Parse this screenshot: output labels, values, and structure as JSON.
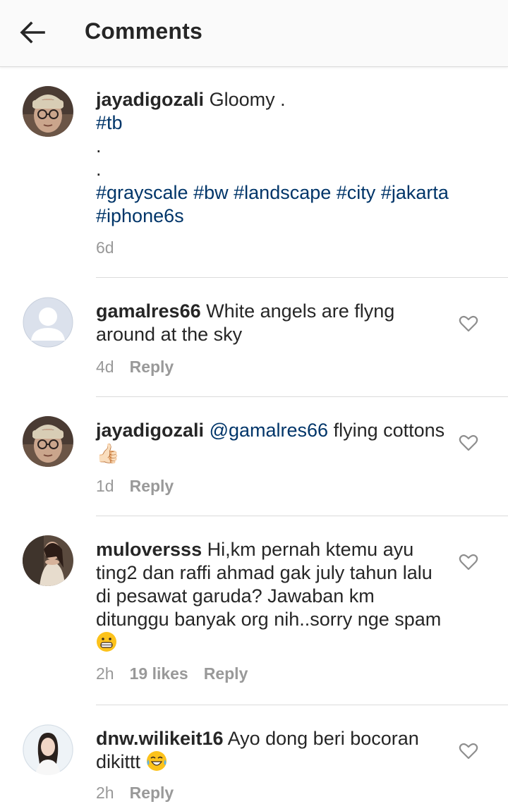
{
  "header": {
    "title": "Comments",
    "back_icon": "arrow-left-icon"
  },
  "caption": {
    "username": "jayadigozali",
    "text": "Gloomy .",
    "tag_tb": "#tb",
    "dot1": ".",
    "dot2": ".",
    "tags": [
      "#grayscale",
      "#bw",
      "#landscape",
      "#city",
      "#jakarta",
      "#iphone6s"
    ],
    "time": "6d"
  },
  "comments": [
    {
      "username": "gamalres66",
      "text": "White angels are flyng around at the sky",
      "time": "4d",
      "reply": "Reply"
    },
    {
      "username": "jayadigozali",
      "mention": "@gamalres66",
      "text": "flying cottons",
      "trailing": "👍🏻",
      "time": "1d",
      "reply": "Reply"
    },
    {
      "username": "muloversss",
      "text": "Hi,km pernah ktemu ayu ting2 dan raffi ahmad gak july tahun lalu di pesawat garuda? Jawaban km ditunggu banyak org nih..sorry nge spam",
      "time": "2h",
      "likes": "19 likes",
      "reply": "Reply"
    },
    {
      "username": "dnw.wilikeit16",
      "text": "Ayo dong beri bocoran dikittt",
      "time": "2h",
      "reply": "Reply"
    }
  ],
  "colors": {
    "hashtag": "#003569",
    "meta": "#999999",
    "divider": "#dbdbdb"
  }
}
